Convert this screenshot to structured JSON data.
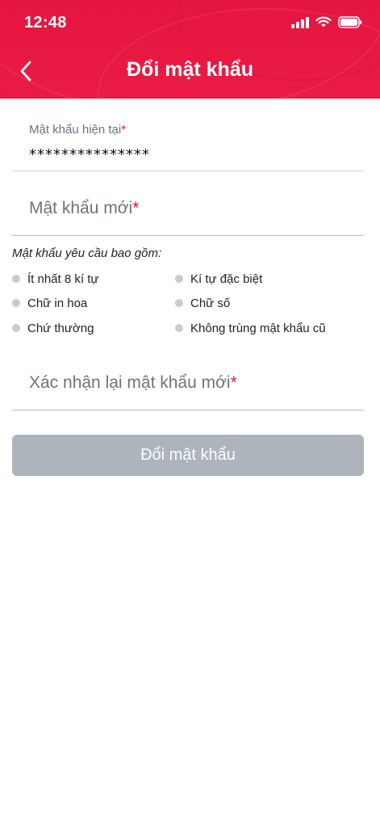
{
  "status_bar": {
    "time": "12:48",
    "icons": [
      "signal-icon",
      "wifi-icon",
      "battery-icon"
    ]
  },
  "header": {
    "title": "Đổi mật khẩu",
    "back_icon": "chevron-left-icon"
  },
  "current_password": {
    "label": "Mật khẩu hiện tại",
    "required_mark": "*",
    "value": "***************"
  },
  "new_password": {
    "placeholder": "Mật khẩu mới",
    "required_mark": "*"
  },
  "requirements": {
    "title": "Mật khẩu yêu cầu bao gồm:",
    "items": [
      "Ít nhất 8 kí tự",
      "Kí tự đặc biệt",
      "Chữ in hoa",
      "Chữ số",
      "Chứ thường",
      "Không trùng mật khẩu cũ"
    ]
  },
  "confirm_password": {
    "placeholder": "Xác nhận lại mật khẩu mới",
    "required_mark": "*"
  },
  "submit": {
    "label": "Đổi mật khẩu"
  },
  "colors": {
    "brand": "#e4153f",
    "button_disabled": "#adb4bb",
    "dot": "#c8ccd1"
  }
}
